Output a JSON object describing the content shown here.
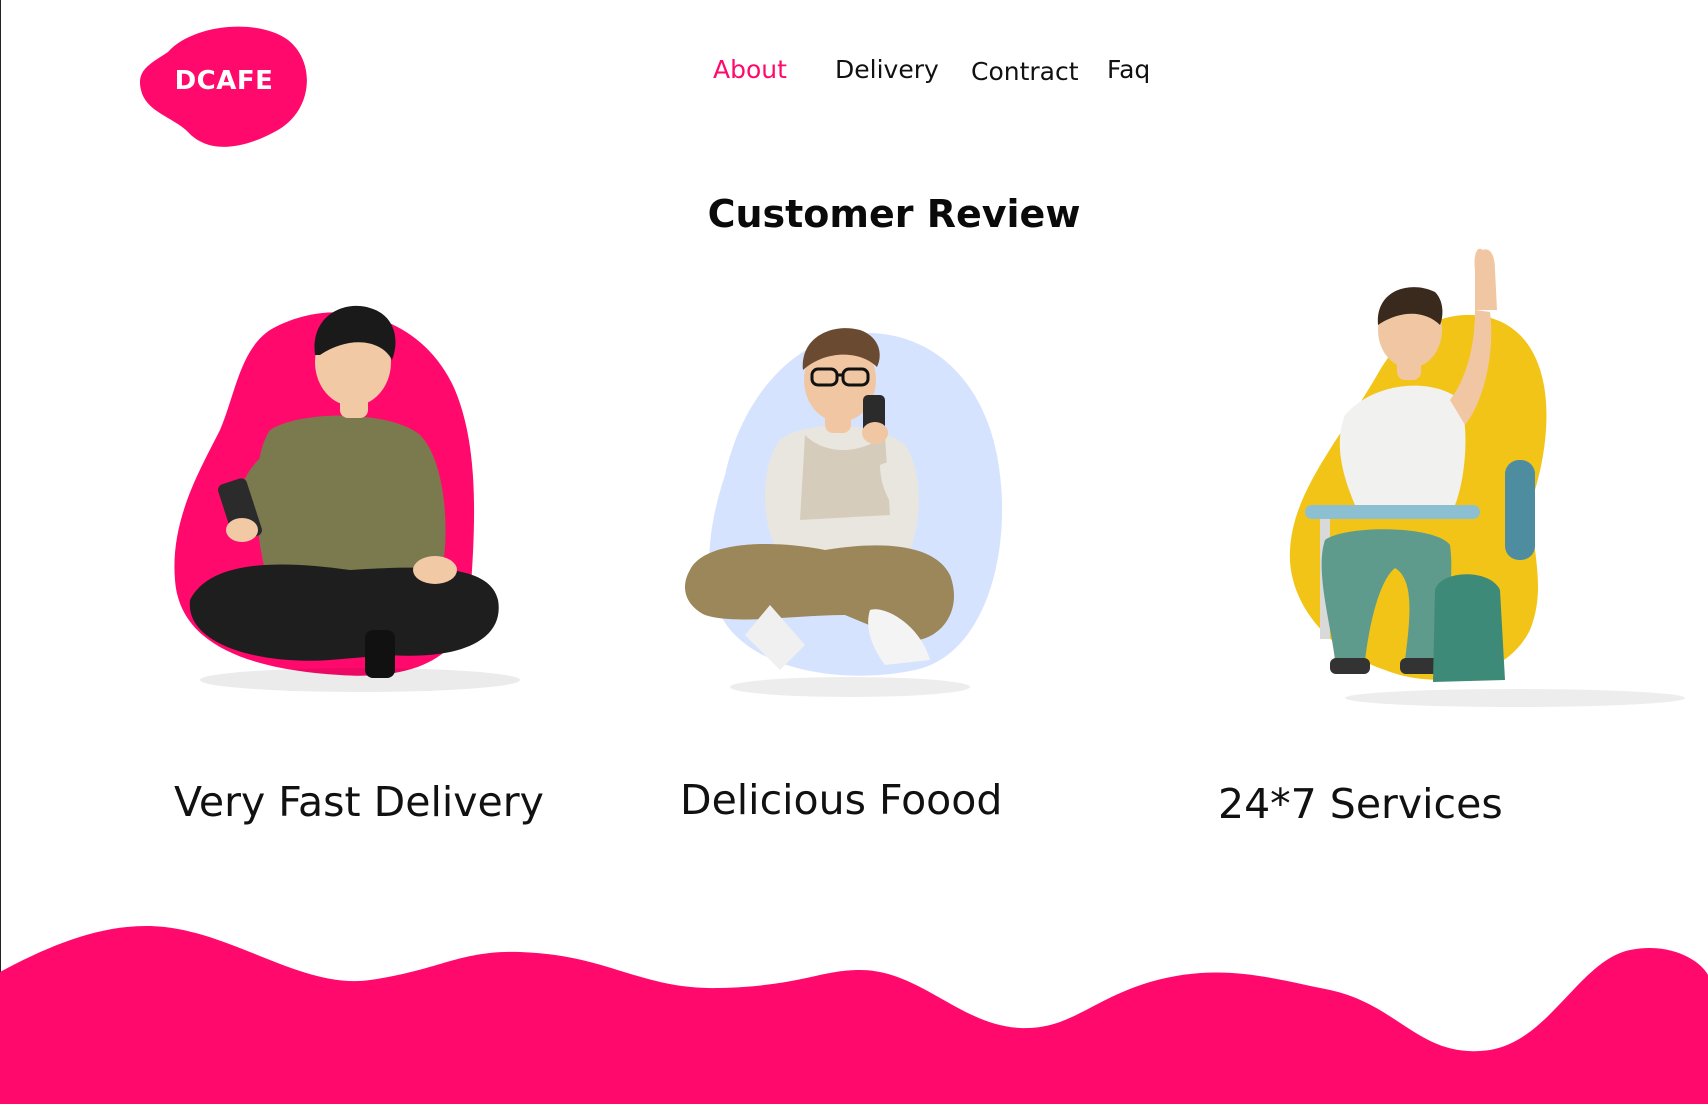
{
  "brand": {
    "name": "DCAFE",
    "color": "#ff0a6c"
  },
  "nav": {
    "items": [
      {
        "label": "About",
        "active": true
      },
      {
        "label": "Delivery",
        "active": false
      },
      {
        "label": "Contract",
        "active": false
      },
      {
        "label": "Faq",
        "active": false
      }
    ]
  },
  "section": {
    "title": "Customer Review"
  },
  "cards": [
    {
      "label": "Very Fast Delivery",
      "blob_color": "#ff0a6c",
      "illustration": "person-sitting-with-phone"
    },
    {
      "label": "Delicious Foood",
      "blob_color": "#d6e3ff",
      "illustration": "person-with-glasses-and-phone"
    },
    {
      "label": "24*7 Services",
      "blob_color": "#f2c418",
      "illustration": "student-at-desk-waving"
    }
  ],
  "footer": {
    "wave_color": "#ff0a6c"
  }
}
